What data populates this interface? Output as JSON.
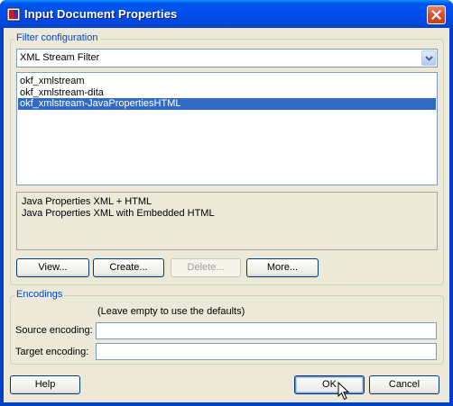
{
  "window": {
    "title": "Input Document Properties",
    "accent": "#0053ee",
    "close_icon": "close-icon"
  },
  "filter_config": {
    "group_label": "Filter configuration",
    "combo_value": "XML Stream Filter",
    "list_items": [
      {
        "label": "okf_xmlstream",
        "selected": false
      },
      {
        "label": "okf_xmlstream-dita",
        "selected": false
      },
      {
        "label": "okf_xmlstream-JavaPropertiesHTML",
        "selected": true
      }
    ],
    "description_lines": [
      "Java Properties XML + HTML",
      "Java Properties XML with Embedded HTML"
    ],
    "buttons": {
      "view": "View...",
      "create": "Create...",
      "delete": "Delete...",
      "more": "More..."
    }
  },
  "encodings": {
    "group_label": "Encodings",
    "hint": "(Leave empty to use the defaults)",
    "source_label": "Source encoding:",
    "source_value": "",
    "target_label": "Target encoding:",
    "target_value": ""
  },
  "footer": {
    "help": "Help",
    "ok": "OK",
    "cancel": "Cancel"
  }
}
